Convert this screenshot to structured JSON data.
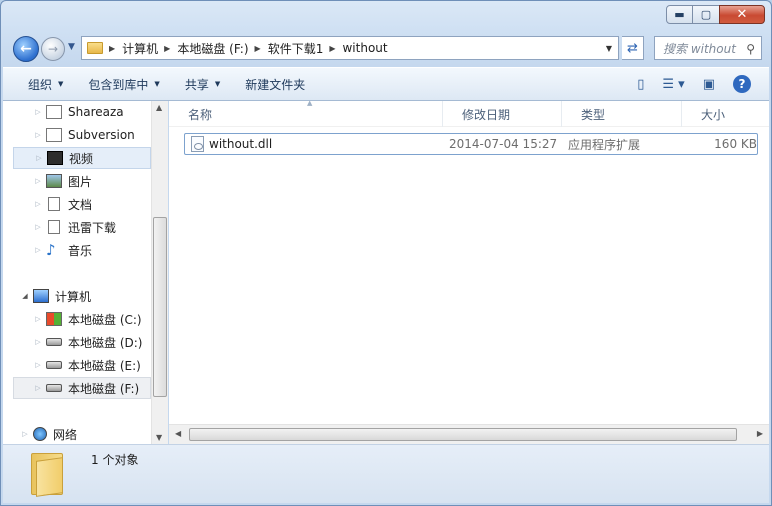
{
  "window": {
    "caption": {
      "minimize": "▬",
      "maximize": "▢",
      "close": "✕"
    }
  },
  "address": {
    "crumbs": [
      "计算机",
      "本地磁盘 (F:)",
      "软件下载1",
      "without"
    ],
    "search_placeholder": "搜索 without"
  },
  "toolbar": {
    "organize": "组织",
    "include_in_library": "包含到库中",
    "share": "共享",
    "new_folder": "新建文件夹"
  },
  "nav": {
    "items": [
      {
        "label": "Shareaza",
        "icon": "window-icon"
      },
      {
        "label": "Subversion",
        "icon": "window-icon"
      },
      {
        "label": "视频",
        "icon": "film-icon"
      },
      {
        "label": "图片",
        "icon": "picture-icon"
      },
      {
        "label": "文档",
        "icon": "document-icon"
      },
      {
        "label": "迅雷下载",
        "icon": "document-icon"
      },
      {
        "label": "音乐",
        "icon": "music-icon"
      },
      {
        "label": "计算机",
        "icon": "computer-icon"
      },
      {
        "label": "本地磁盘 (C:)",
        "icon": "windows-drive-icon"
      },
      {
        "label": "本地磁盘 (D:)",
        "icon": "drive-icon"
      },
      {
        "label": "本地磁盘 (E:)",
        "icon": "drive-icon"
      },
      {
        "label": "本地磁盘 (F:)",
        "icon": "drive-icon"
      },
      {
        "label": "网络",
        "icon": "network-icon"
      }
    ]
  },
  "columns": {
    "name": "名称",
    "modified": "修改日期",
    "type": "类型",
    "size": "大小"
  },
  "files": [
    {
      "name": "without.dll",
      "modified": "2014-07-04 15:27",
      "type": "应用程序扩展",
      "size": "160 KB"
    }
  ],
  "status": {
    "text": "1 个对象"
  }
}
